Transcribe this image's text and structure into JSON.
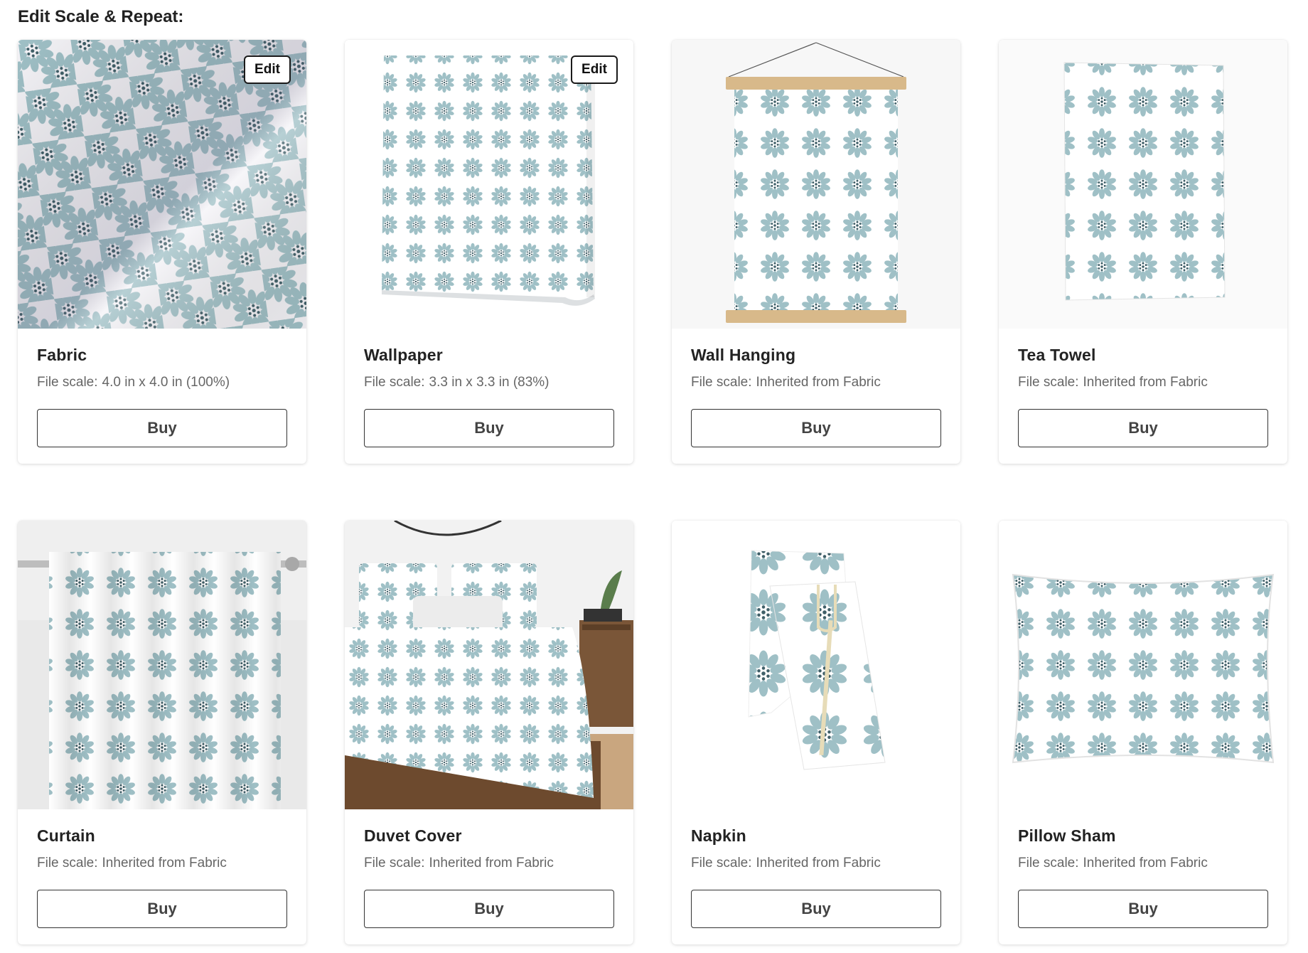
{
  "heading": "Edit Scale & Repeat:",
  "colors": {
    "motif_light": "#9fc0c6",
    "motif_dark": "#3f5f68",
    "border": "#1a1a1a"
  },
  "scale_label": "File scale:",
  "buy_label": "Buy",
  "edit_label": "Edit",
  "products": [
    {
      "name": "Fabric",
      "scale": "4.0 in x 4.0 in (100%)",
      "editable": true
    },
    {
      "name": "Wallpaper",
      "scale": "3.3 in x 3.3 in (83%)",
      "editable": true
    },
    {
      "name": "Wall Hanging",
      "scale": "Inherited from Fabric",
      "editable": false
    },
    {
      "name": "Tea Towel",
      "scale": "Inherited from Fabric",
      "editable": false
    },
    {
      "name": "Curtain",
      "scale": "Inherited from Fabric",
      "editable": false
    },
    {
      "name": "Duvet Cover",
      "scale": "Inherited from Fabric",
      "editable": false
    },
    {
      "name": "Napkin",
      "scale": "Inherited from Fabric",
      "editable": false
    },
    {
      "name": "Pillow Sham",
      "scale": "Inherited from Fabric",
      "editable": false
    }
  ]
}
